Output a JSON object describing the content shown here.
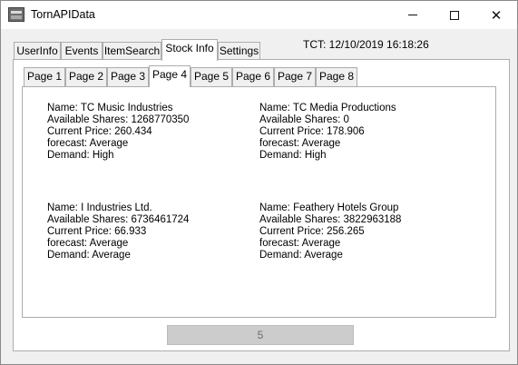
{
  "window": {
    "title": "TornAPIData"
  },
  "main_tabs": [
    "UserInfo",
    "Events",
    "ItemSearch",
    "Stock Info",
    "Settings"
  ],
  "tct": "TCT: 12/10/2019 16:18:26",
  "page_tabs": [
    "Page 1",
    "Page 2",
    "Page 3",
    "Page 4",
    "Page 5",
    "Page 6",
    "Page 7",
    "Page 8"
  ],
  "stocks": [
    {
      "name": "Name: TC Music Industries",
      "shares": "Available Shares: 1268770350",
      "price": "Current Price: 260.434",
      "forecast": "forecast: Average",
      "demand": "Demand: High"
    },
    {
      "name": "Name: TC Media Productions",
      "shares": "Available Shares: 0",
      "price": "Current Price: 178.906",
      "forecast": "forecast: Average",
      "demand": "Demand: High"
    },
    {
      "name": "Name: I Industries Ltd.",
      "shares": "Available Shares: 6736461724",
      "price": "Current Price: 66.933",
      "forecast": "forecast: Average",
      "demand": "Demand: Average"
    },
    {
      "name": "Name: Feathery Hotels Group",
      "shares": "Available Shares: 3822963188",
      "price": "Current Price: 256.265",
      "forecast": "forecast: Average",
      "demand": "Demand: Average"
    }
  ],
  "progress_label": "5"
}
